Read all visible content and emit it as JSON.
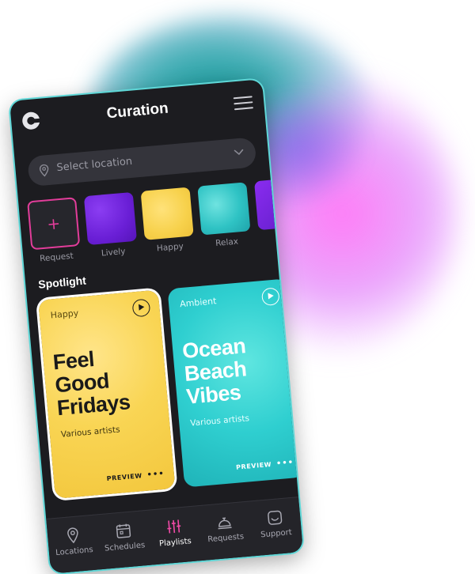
{
  "app": {
    "title": "Curation"
  },
  "location": {
    "placeholder": "Select location"
  },
  "moods": [
    {
      "label": "Request",
      "type": "request"
    },
    {
      "label": "Lively"
    },
    {
      "label": "Happy"
    },
    {
      "label": "Relax"
    }
  ],
  "spotlight": {
    "title": "Spotlight",
    "cards": [
      {
        "tag": "Happy",
        "title_lines": [
          "Feel",
          "Good",
          "Fridays"
        ],
        "subtitle": "Various artists",
        "preview": "PREVIEW"
      },
      {
        "tag": "Ambient",
        "title_lines": [
          "Ocean",
          "Beach",
          "Vibes"
        ],
        "subtitle": "Various artists",
        "preview": "PREVIEW"
      }
    ]
  },
  "tabs": [
    {
      "label": "Locations",
      "icon": "location-pin-icon"
    },
    {
      "label": "Schedules",
      "icon": "calendar-icon"
    },
    {
      "label": "Playlists",
      "icon": "equalizer-icon",
      "active": true
    },
    {
      "label": "Requests",
      "icon": "service-bell-icon"
    },
    {
      "label": "Support",
      "icon": "support-chat-icon"
    }
  ],
  "colors": {
    "accent_pink": "#e23d9a",
    "frame_teal": "#5fd7d7",
    "happy_yellow": "#f7d14b",
    "ambient_teal": "#2fcfd0",
    "lively_purple": "#6a1fd6"
  }
}
